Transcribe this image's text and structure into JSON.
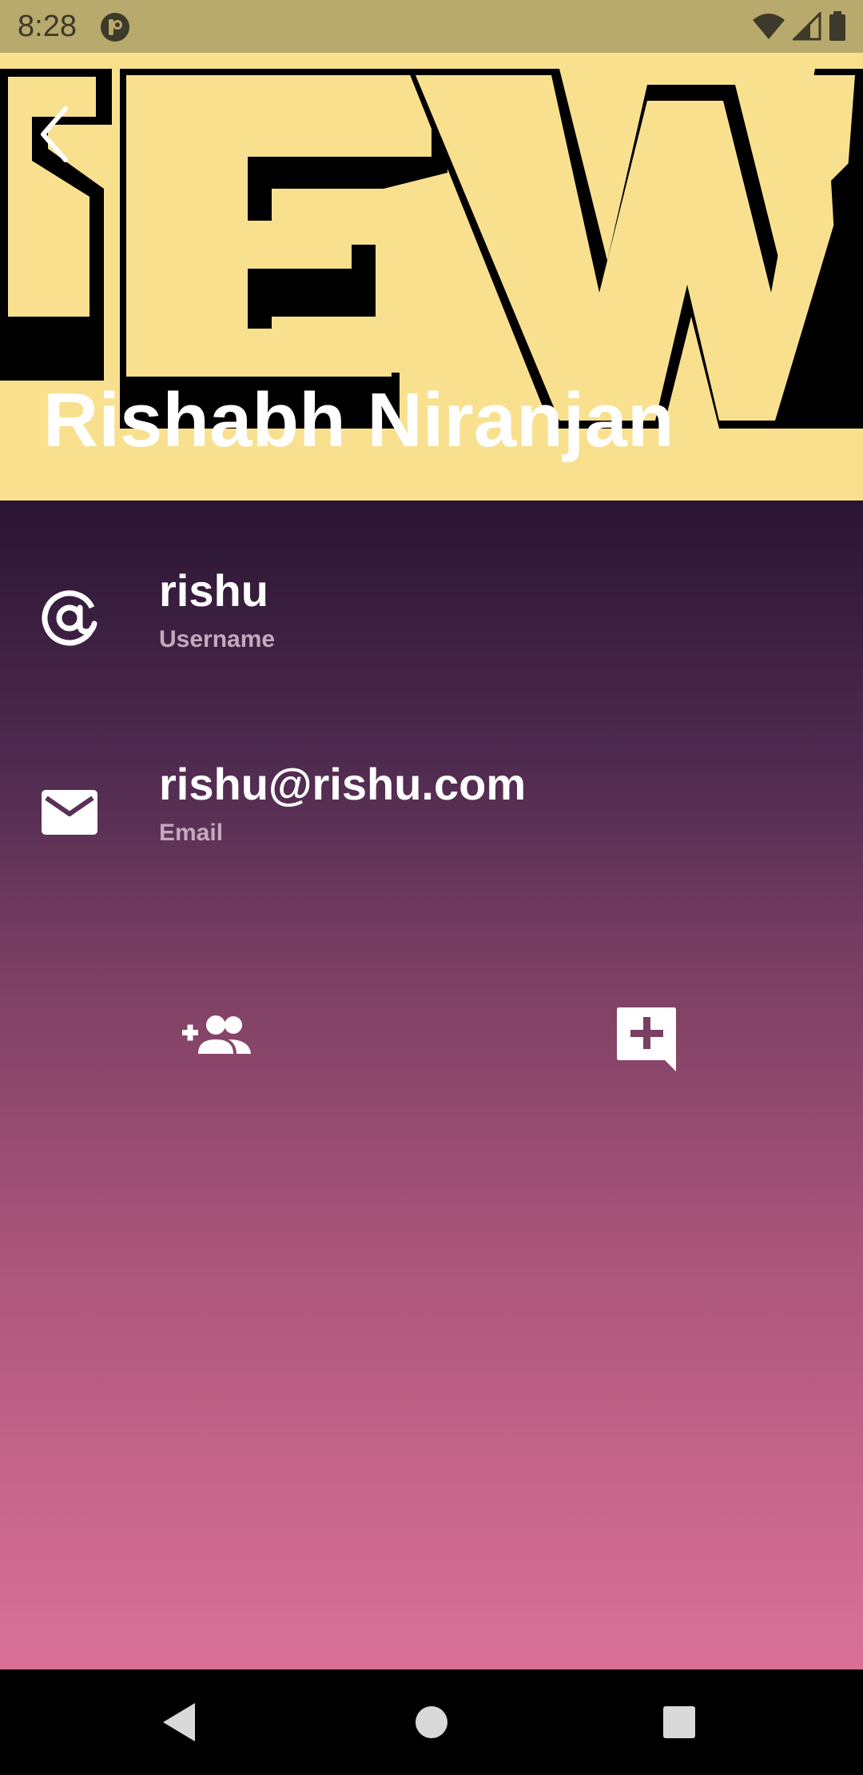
{
  "status_bar": {
    "time": "8:28",
    "background_color": "#b8a96c",
    "icons": [
      "app-notification-icon",
      "wifi-icon",
      "signal-icon",
      "battery-icon"
    ]
  },
  "header": {
    "background_color": "#f8e08f",
    "back_icon": "back-arrow-icon",
    "name": "Rishabh Niranjan"
  },
  "details": [
    {
      "icon": "at-sign-icon",
      "value": "rishu",
      "label": "Username"
    },
    {
      "icon": "mail-icon",
      "value": "rishu@rishu.com",
      "label": "Email"
    }
  ],
  "actions": [
    {
      "icon": "add-friend-icon"
    },
    {
      "icon": "add-message-icon"
    }
  ],
  "theme": {
    "gradient_top": "#2a1533",
    "gradient_bottom": "#d97197",
    "label_color": "#c4a9bd"
  },
  "nav_bar": {
    "icons": [
      "nav-back-icon",
      "nav-home-icon",
      "nav-recents-icon"
    ]
  }
}
